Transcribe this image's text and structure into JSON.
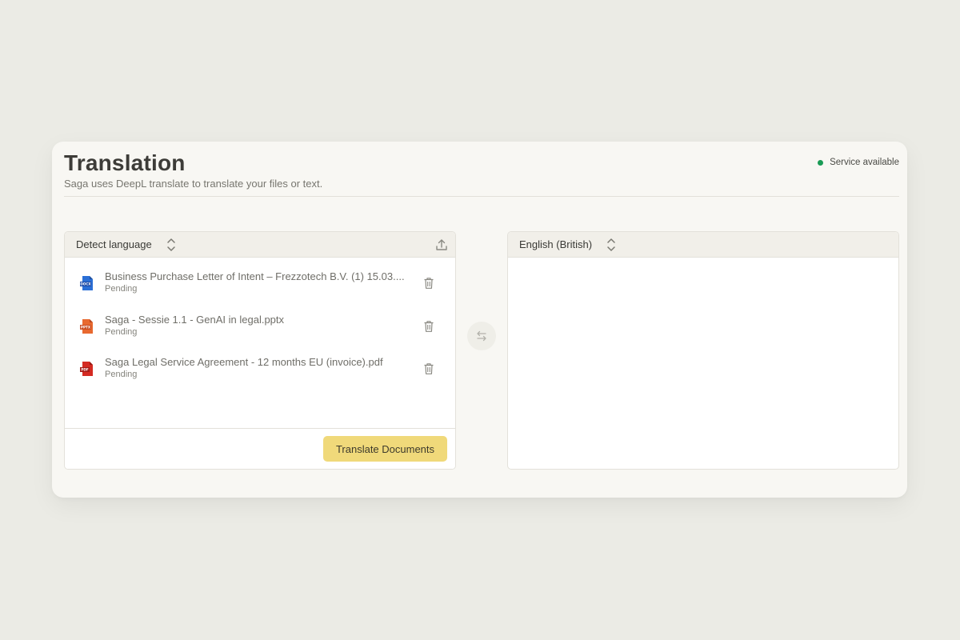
{
  "header": {
    "title": "Translation",
    "subtitle": "Saga uses DeepL translate to translate your files or text.",
    "status_text": "Service available",
    "status_color": "#1a9b55"
  },
  "source": {
    "language": "Detect language",
    "upload_icon": "upload-icon",
    "files": [
      {
        "name": "Business Purchase Letter of Intent – Frezzotech B.V. (1) 15.03....",
        "status": "Pending",
        "type": "DOCX",
        "color": "#2b6fd6"
      },
      {
        "name": "Saga - Sessie 1.1 - GenAI in legal.pptx",
        "status": "Pending",
        "type": "PPTX",
        "color": "#d9562b"
      },
      {
        "name": "Saga Legal Service Agreement - 12 months EU (invoice).pdf",
        "status": "Pending",
        "type": "PDF",
        "color": "#c8231e"
      }
    ],
    "translate_button": "Translate Documents",
    "button_color": "#f0d97a"
  },
  "target": {
    "language": "English (British)"
  }
}
